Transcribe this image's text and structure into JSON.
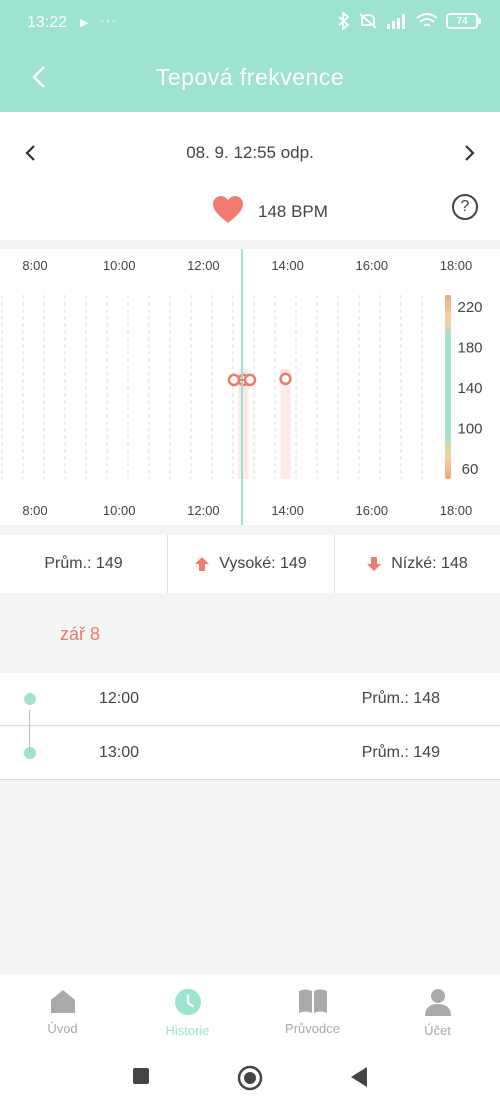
{
  "status_bar": {
    "time": "13:22",
    "battery": "74"
  },
  "header": {
    "title": "Tepová frekvence"
  },
  "date_nav": {
    "date": "08. 9. 12:55 odp."
  },
  "current": {
    "bpm": "148 BPM"
  },
  "chart": {
    "x_labels": [
      "8:00",
      "10:00",
      "12:00",
      "14:00",
      "16:00",
      "18:00"
    ],
    "y_labels": [
      "220",
      "180",
      "140",
      "100",
      "60"
    ],
    "accent": "#9ee3cf",
    "marker_color": "#e87b6a"
  },
  "chart_data": {
    "type": "scatter",
    "title": "",
    "xlabel": "",
    "ylabel": "",
    "x_ticks": [
      "8:00",
      "10:00",
      "12:00",
      "14:00",
      "16:00",
      "18:00"
    ],
    "y_ticks": [
      220,
      180,
      140,
      100,
      60
    ],
    "ylim": [
      60,
      220
    ],
    "series": [
      {
        "x": [
          "12:00",
          "13:00"
        ],
        "values": [
          148,
          149
        ]
      }
    ],
    "selected": {
      "time": "12:55",
      "value": 148
    }
  },
  "stats": {
    "avg": "Prům.: 149",
    "high": "Vysoké: 149",
    "low": "Nízké: 148"
  },
  "day": {
    "label": "zář 8"
  },
  "history": [
    {
      "time": "12:00",
      "avg": "Prům.: 148"
    },
    {
      "time": "13:00",
      "avg": "Prům.: 149"
    }
  ],
  "nav": [
    {
      "label": "Úvod",
      "icon": "home-icon"
    },
    {
      "label": "Historie",
      "icon": "clock-icon"
    },
    {
      "label": "Průvodce",
      "icon": "book-icon"
    },
    {
      "label": "Účet",
      "icon": "user-icon"
    }
  ]
}
